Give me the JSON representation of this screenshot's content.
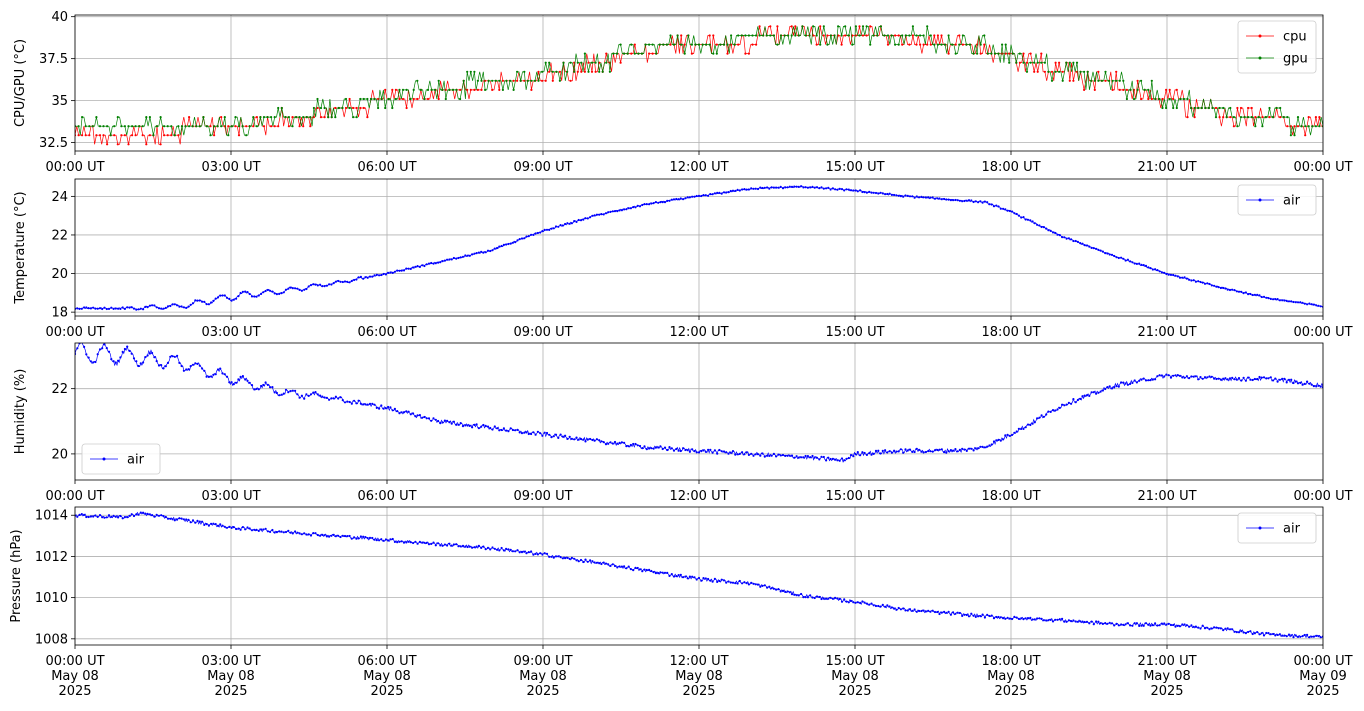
{
  "figure": {
    "x_ticks": [
      "00:00 UT",
      "03:00 UT",
      "06:00 UT",
      "09:00 UT",
      "12:00 UT",
      "15:00 UT",
      "18:00 UT",
      "21:00 UT",
      "00:00 UT"
    ],
    "x_date_lines": [
      "May 08",
      "May 08",
      "May 08",
      "May 08",
      "May 08",
      "May 08",
      "May 08",
      "May 08",
      "May 09"
    ],
    "x_year_lines": [
      "2025",
      "2025",
      "2025",
      "2025",
      "2025",
      "2025",
      "2025",
      "2025",
      "2025"
    ]
  },
  "chart_data": [
    {
      "type": "line",
      "ylabel": "CPU/GPU (°C)",
      "ylim": [
        32.0,
        40.1
      ],
      "yticks": [
        32.5,
        35.0,
        37.5,
        40.0
      ],
      "grid": true,
      "legend": "top-right",
      "x_unit": "hour",
      "xlim": [
        0,
        24
      ],
      "series": [
        {
          "name": "cpu",
          "color": "#ff0000",
          "x": [
            0,
            1,
            2,
            3,
            4,
            5,
            6,
            7,
            8,
            9,
            10,
            11,
            12,
            13,
            14,
            15,
            16,
            17,
            18,
            19,
            20,
            21,
            22,
            23,
            24
          ],
          "y": [
            33.2,
            33.2,
            33.2,
            33.4,
            33.8,
            34.4,
            35.0,
            35.5,
            36.0,
            36.4,
            37.2,
            38.0,
            38.3,
            38.6,
            38.7,
            38.7,
            38.6,
            38.4,
            37.6,
            36.6,
            36.0,
            35.1,
            34.3,
            33.8,
            33.4
          ]
        },
        {
          "name": "gpu",
          "color": "#008000",
          "x": [
            0,
            1,
            2,
            3,
            4,
            5,
            6,
            7,
            8,
            9,
            10,
            11,
            12,
            13,
            14,
            15,
            16,
            17,
            18,
            19,
            20,
            21,
            22,
            23,
            24
          ],
          "y": [
            33.3,
            33.3,
            33.3,
            33.5,
            33.9,
            34.5,
            35.1,
            35.7,
            36.1,
            36.5,
            37.3,
            38.1,
            38.4,
            38.7,
            38.8,
            38.8,
            38.7,
            38.5,
            37.7,
            36.7,
            36.1,
            35.2,
            34.4,
            33.9,
            33.5
          ]
        }
      ]
    },
    {
      "type": "line",
      "ylabel": "Temperature (°C)",
      "ylim": [
        17.8,
        24.9
      ],
      "yticks": [
        18,
        20,
        22,
        24
      ],
      "grid": true,
      "legend": "top-right",
      "x_unit": "hour",
      "xlim": [
        0,
        24
      ],
      "series": [
        {
          "name": "air",
          "color": "#0000ff",
          "x": [
            0,
            1,
            2,
            3,
            4,
            5,
            6,
            7,
            8,
            9,
            10,
            11,
            12,
            13,
            14,
            15,
            16,
            17,
            17.5,
            18,
            19,
            20,
            21,
            22,
            23,
            24
          ],
          "y": [
            18.2,
            18.2,
            18.3,
            18.8,
            19.1,
            19.5,
            20.0,
            20.6,
            21.2,
            22.2,
            23.0,
            23.6,
            24.0,
            24.4,
            24.5,
            24.3,
            24.0,
            23.8,
            23.7,
            23.2,
            21.9,
            20.9,
            20.0,
            19.3,
            18.7,
            18.3
          ]
        }
      ]
    },
    {
      "type": "line",
      "ylabel": "Humidity (%)",
      "ylim": [
        19.2,
        23.4
      ],
      "yticks": [
        20,
        22
      ],
      "grid": true,
      "legend": "bottom-left",
      "x_unit": "hour",
      "xlim": [
        0,
        24
      ],
      "series": [
        {
          "name": "air",
          "color": "#0000ff",
          "x": [
            0,
            1,
            2,
            3,
            4,
            5,
            6,
            7,
            8,
            9,
            10,
            11,
            12,
            13,
            14,
            14.8,
            15,
            16,
            17,
            17.5,
            18,
            19,
            20,
            21,
            22,
            23,
            24
          ],
          "y": [
            23.1,
            23.0,
            22.8,
            22.3,
            21.9,
            21.7,
            21.4,
            21.0,
            20.8,
            20.6,
            20.4,
            20.2,
            20.1,
            20.0,
            19.9,
            19.8,
            20.0,
            20.1,
            20.1,
            20.2,
            20.6,
            21.5,
            22.1,
            22.4,
            22.3,
            22.3,
            22.1
          ]
        }
      ]
    },
    {
      "type": "line",
      "ylabel": "Pressure (hPa)",
      "ylim": [
        1007.7,
        1014.4
      ],
      "yticks": [
        1008,
        1010,
        1012,
        1014
      ],
      "grid": true,
      "legend": "top-right",
      "x_unit": "hour",
      "xlim": [
        0,
        24
      ],
      "series": [
        {
          "name": "air",
          "color": "#0000ff",
          "x": [
            0,
            1,
            1.2,
            2,
            3,
            4,
            5,
            6,
            7,
            8,
            9,
            10,
            11,
            12,
            13,
            14,
            15,
            16,
            17,
            18,
            19,
            20,
            21,
            22,
            23,
            24
          ],
          "y": [
            1014.0,
            1013.9,
            1014.1,
            1013.8,
            1013.4,
            1013.2,
            1013.0,
            1012.8,
            1012.6,
            1012.4,
            1012.1,
            1011.7,
            1011.3,
            1010.9,
            1010.7,
            1010.1,
            1009.8,
            1009.4,
            1009.2,
            1009.0,
            1008.9,
            1008.7,
            1008.7,
            1008.5,
            1008.2,
            1008.1
          ]
        }
      ]
    }
  ]
}
